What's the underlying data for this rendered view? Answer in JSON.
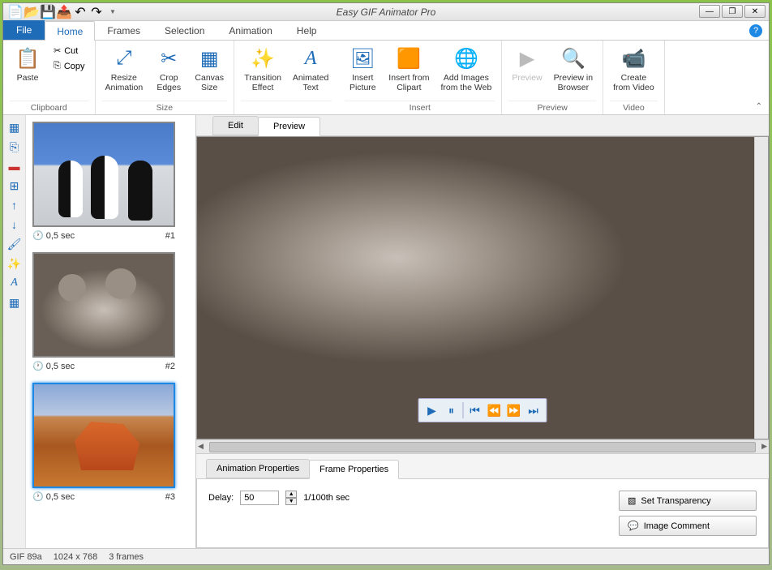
{
  "app_title": "Easy GIF Animator Pro",
  "window_controls": {
    "min": "—",
    "max": "❐",
    "close": "✕"
  },
  "qat": [
    "new-icon",
    "open-icon",
    "save-icon",
    "export-icon",
    "undo-icon",
    "redo-icon"
  ],
  "tabs": {
    "file": "File",
    "items": [
      "Home",
      "Frames",
      "Selection",
      "Animation",
      "Help"
    ],
    "active": "Home"
  },
  "ribbon": {
    "clipboard": {
      "paste": "Paste",
      "cut": "Cut",
      "copy": "Copy",
      "title": "Clipboard"
    },
    "size": {
      "resize": "Resize\nAnimation",
      "crop": "Crop\nEdges",
      "canvas": "Canvas\nSize",
      "title": "Size"
    },
    "effects": {
      "transition": "Transition\nEffect",
      "text": "Animated\nText"
    },
    "insert": {
      "picture": "Insert\nPicture",
      "clipart": "Insert from\nClipart",
      "web": "Add Images\nfrom the Web",
      "title": "Insert"
    },
    "preview": {
      "preview": "Preview",
      "browser": "Preview in\nBrowser",
      "title": "Preview"
    },
    "video": {
      "create": "Create\nfrom Video",
      "title": "Video"
    }
  },
  "tools": [
    "frame-add",
    "frame-dup",
    "frame-del",
    "frame-merge",
    "arrow-up",
    "arrow-down",
    "paint",
    "wand",
    "text",
    "grid"
  ],
  "frames": [
    {
      "duration": "0,5 sec",
      "index": "#1",
      "img": "penguins"
    },
    {
      "duration": "0,5 sec",
      "index": "#2",
      "img": "koala-thumb"
    },
    {
      "duration": "0,5 sec",
      "index": "#3",
      "img": "desert",
      "selected": true
    }
  ],
  "preview_tabs": {
    "edit": "Edit",
    "preview": "Preview",
    "active": "Preview"
  },
  "play": [
    "play",
    "pause",
    "sep",
    "first",
    "prev",
    "next",
    "last"
  ],
  "props": {
    "tabs": {
      "anim": "Animation Properties",
      "frame": "Frame Properties",
      "active": "Frame Properties"
    },
    "delay_label": "Delay:",
    "delay_value": "50",
    "delay_unit": "1/100th sec",
    "buttons": {
      "transparency": "Set Transparency",
      "comment": "Image Comment"
    }
  },
  "status": {
    "format": "GIF 89a",
    "dims": "1024 x 768",
    "frames": "3 frames"
  }
}
